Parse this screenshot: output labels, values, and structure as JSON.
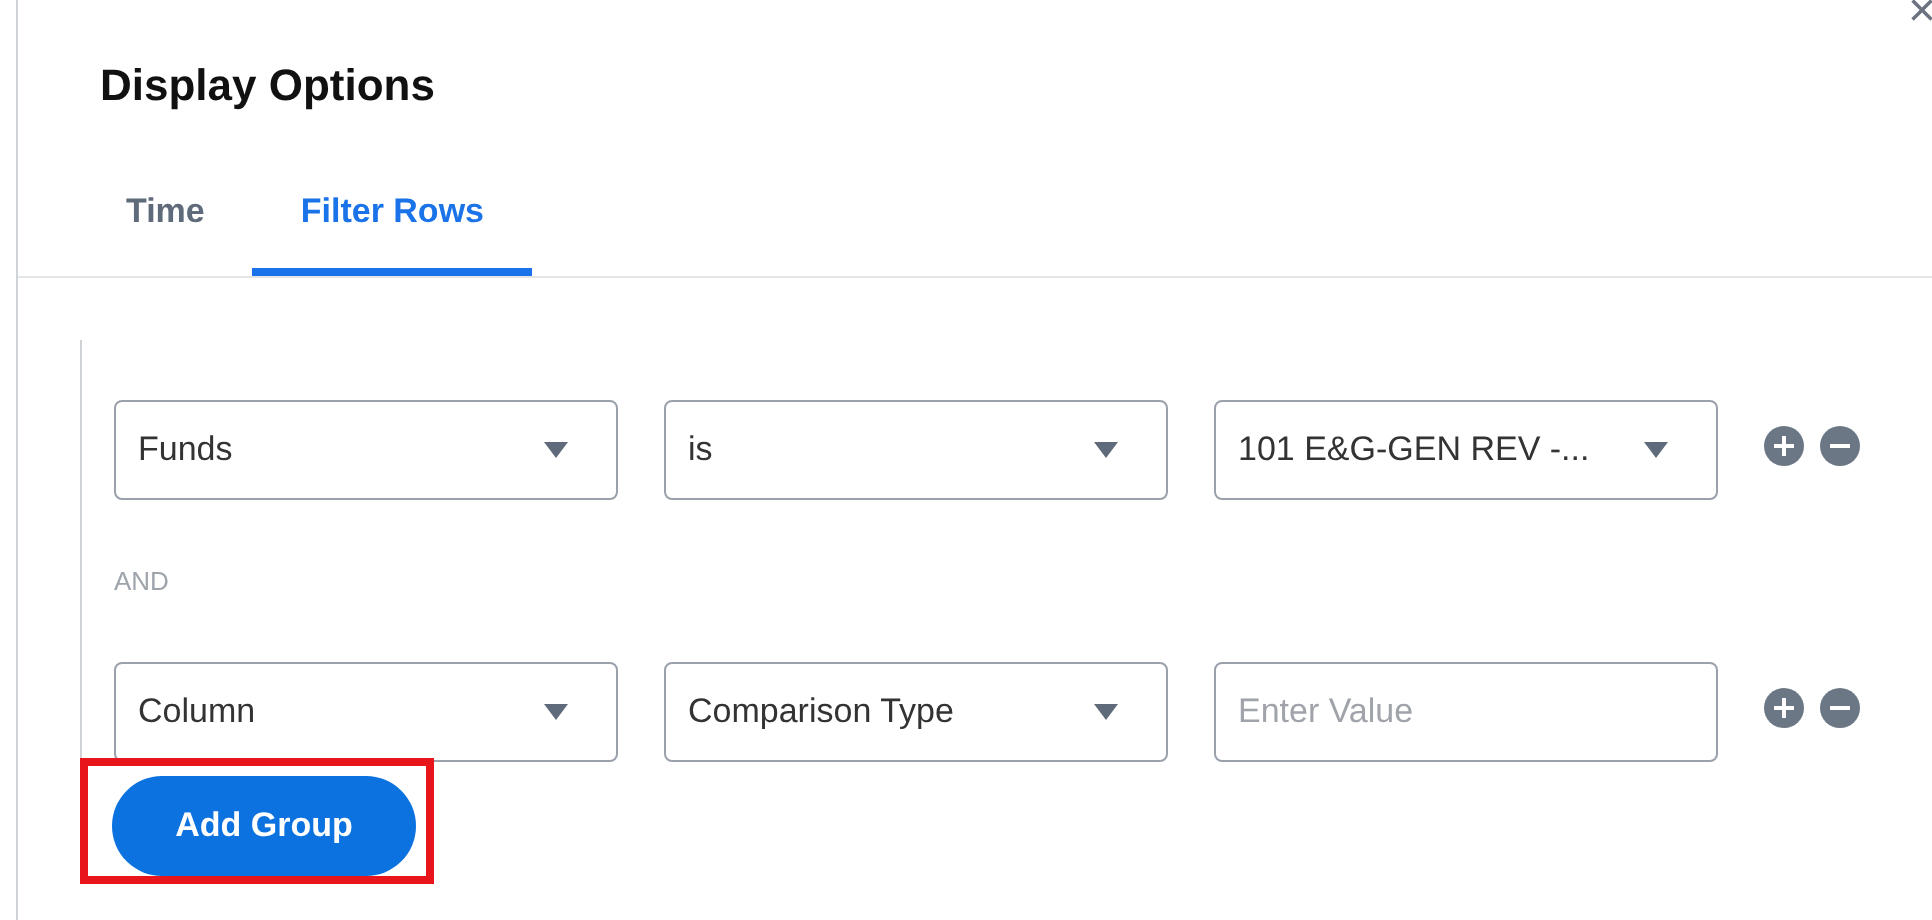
{
  "dialog": {
    "title": "Display Options",
    "close": "×"
  },
  "tabs": [
    {
      "label": "Time",
      "selected": false
    },
    {
      "label": "Filter Rows",
      "selected": true
    }
  ],
  "filter_rows": [
    {
      "fields": [
        {
          "kind": "select",
          "value": "Funds"
        },
        {
          "kind": "select",
          "value": "is"
        },
        {
          "kind": "select",
          "value": "101 E&G-GEN REV -..."
        }
      ]
    },
    {
      "fields": [
        {
          "kind": "select",
          "value": "Column"
        },
        {
          "kind": "select",
          "value": "Comparison Type"
        },
        {
          "kind": "input",
          "placeholder": "Enter Value"
        }
      ]
    }
  ],
  "joiner": "AND",
  "add_group": {
    "label": "Add Group",
    "highlighted": true
  }
}
